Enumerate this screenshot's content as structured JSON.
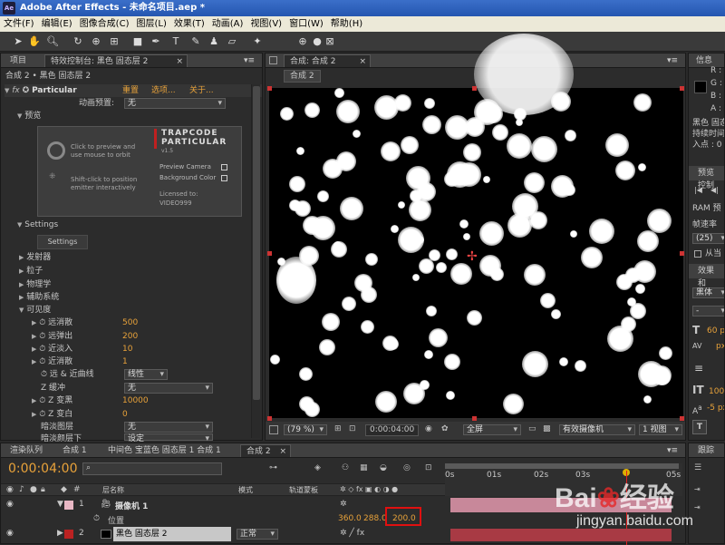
{
  "app": {
    "title": "Adobe After Effects - 未命名项目.aep *",
    "icon": "Ae"
  },
  "menu": [
    "文件(F)",
    "编辑(E)",
    "图像合成(C)",
    "图层(L)",
    "效果(T)",
    "动画(A)",
    "视图(V)",
    "窗口(W)",
    "帮助(H)"
  ],
  "left_panel": {
    "tab_project": "项目",
    "tab_effects": "特效控制台: 黑色 固态层 2",
    "breadcrumb": "合成 2 • 黑色 固态层 2",
    "effect_name": "Particular",
    "reset": "重置",
    "options": "选项...",
    "about": "关于...",
    "preset_label": "动画预置:",
    "preset_value": "无",
    "preview_label": "预览",
    "preview_box": {
      "click_text1": "Click to preview and",
      "click_text2": "use mouse to orbit",
      "shift_text1": "Shift-click to position",
      "shift_text2": "emitter interactively",
      "logo1": "TRAPCODE",
      "logo2": "PARTICULAR",
      "version": "v1.5",
      "preview_camera": "Preview Camera",
      "background_color": "Background Color",
      "licensed": "Licensed to:",
      "licensee": "VIDEO999"
    },
    "settings_label": "Settings",
    "settings_button": "Settings",
    "groups": [
      "发射器",
      "粒子",
      "物理学",
      "辅助系统",
      "可见度"
    ],
    "visibility": [
      {
        "label": "远消散",
        "value": "500"
      },
      {
        "label": "远弹出",
        "value": "200"
      },
      {
        "label": "近淡入",
        "value": "10"
      },
      {
        "label": "近消散",
        "value": "1"
      }
    ],
    "curve_label": "远 & 近曲线",
    "curve_value": "线性",
    "zbuffer_label": "Z 缓冲",
    "zbuffer_value": "无",
    "z_far_label": "Z 变黑",
    "z_far_value": "10000",
    "z_near_label": "Z 变白",
    "z_near_value": "0",
    "obscure_label": "暗淡图层",
    "obscure_value": "无",
    "last_label": "暗淡颜层下",
    "last_value": "设定"
  },
  "viewer": {
    "tab": "合成: 合成 2",
    "comp_tab": "合成 2",
    "zoom": "(79 %)",
    "timecode": "0:00:04:00",
    "resolution": "全屏",
    "camera": "有效摄像机",
    "views": "1 视图"
  },
  "right_panel": {
    "info_tab": "信息",
    "channels": [
      "R :",
      "G :",
      "B :",
      "A :"
    ],
    "info_text1": "黑色 固态",
    "info_text2": "持续时间",
    "info_text3": "入点 : 0",
    "preview_tab": "预览控制",
    "ram": "RAM 预",
    "fps_label": "帧速率",
    "fps_value": "(25)",
    "from_current": "从当",
    "effects_tab": "效果和",
    "font_value": "黑体",
    "dash_value": "-",
    "size_value": "60 px",
    "leading_value": "px",
    "tracking_value": "100",
    "baseline_value": "-5 px",
    "t_label": "T"
  },
  "timeline": {
    "tabs": [
      "渲染队列",
      "合成 1",
      "中间色 宝蓝色 固态层 1 合成 1",
      "合成 2"
    ],
    "timecode": "0:00:04:00",
    "search_placeholder": "",
    "col_layer_name": "层名称",
    "col_mode": "模式",
    "col_trkmat": "轨道蒙板",
    "ruler": [
      "0s",
      "01s",
      "02s",
      "03s",
      "05s"
    ],
    "layers": [
      {
        "index": "1",
        "name": "摄像机 1"
      },
      {
        "index": "2",
        "name": "黑色 固态层 2",
        "mode": "正常"
      }
    ],
    "position_label": "位置",
    "position_x": "360.0",
    "position_y": "288.0",
    "position_z": "200.0",
    "track_tab": "跟踪"
  },
  "watermark": {
    "brand": "Bai",
    "brand2": "经验",
    "url": "jingyan.baidu.com"
  }
}
